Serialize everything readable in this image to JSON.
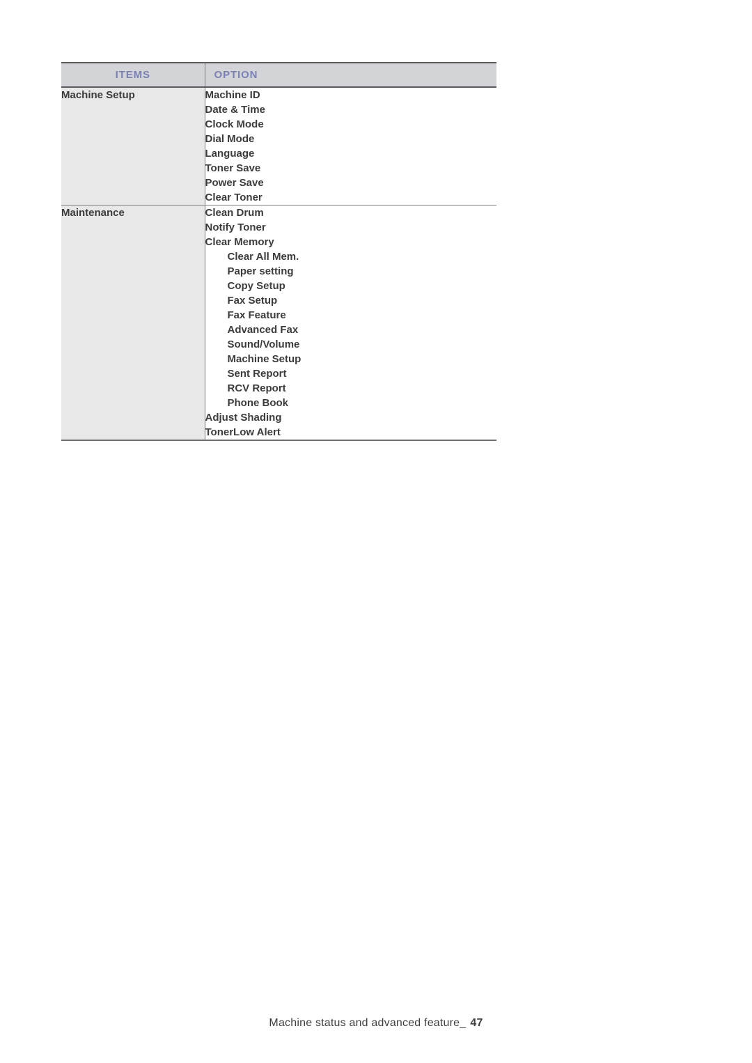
{
  "document": {
    "footer_text": "Machine status and advanced feature_",
    "page_number": "47"
  },
  "colors": {
    "header_text": "#7a80b9",
    "header_fill": "#d2d4d7",
    "items_cell_fill": "#e8e8e8",
    "option_cell_fill": "#ffffff",
    "body_text": "#3c3c3c",
    "rule": "#7c7c7c"
  },
  "table": {
    "headers": {
      "items": "ITEMS",
      "option": "OPTION"
    },
    "rows": [
      {
        "item": "Machine Setup",
        "options": [
          {
            "label": "Machine ID",
            "level": 0
          },
          {
            "label": "Date & Time",
            "level": 0
          },
          {
            "label": "Clock Mode",
            "level": 0
          },
          {
            "label": "Dial Mode",
            "level": 0
          },
          {
            "label": "Language",
            "level": 0
          },
          {
            "label": "Toner Save",
            "level": 0
          },
          {
            "label": "Power Save",
            "level": 0
          },
          {
            "label": "Clear Toner",
            "level": 0
          }
        ]
      },
      {
        "item": "Maintenance",
        "options": [
          {
            "label": "Clean Drum",
            "level": 0
          },
          {
            "label": "Notify Toner",
            "level": 0
          },
          {
            "label": "Clear Memory",
            "level": 0
          },
          {
            "label": "Clear All Mem.",
            "level": 1
          },
          {
            "label": "Paper setting",
            "level": 1
          },
          {
            "label": "Copy Setup",
            "level": 1
          },
          {
            "label": "Fax Setup",
            "level": 1
          },
          {
            "label": "Fax Feature",
            "level": 1
          },
          {
            "label": "Advanced Fax",
            "level": 1
          },
          {
            "label": "Sound/Volume",
            "level": 1
          },
          {
            "label": "Machine Setup",
            "level": 1
          },
          {
            "label": "Sent Report",
            "level": 1
          },
          {
            "label": "RCV Report",
            "level": 1
          },
          {
            "label": "Phone Book",
            "level": 1
          },
          {
            "label": "Adjust Shading",
            "level": 0
          },
          {
            "label": "TonerLow Alert",
            "level": 0
          }
        ]
      }
    ]
  }
}
